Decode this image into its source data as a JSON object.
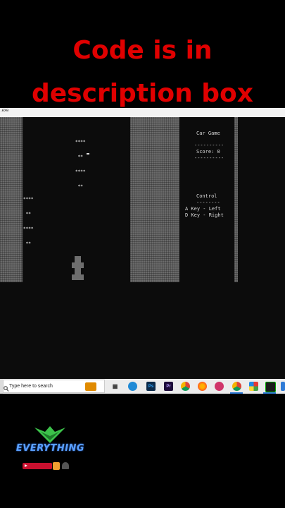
{
  "banner": {
    "line1": "Code is in",
    "line2": "description box"
  },
  "console": {
    "title": ".exe"
  },
  "game": {
    "title": "Car Game",
    "divider": "----------",
    "score_label": "Score: 0",
    "control_title": "Control",
    "control_divider": "--------",
    "control_left": "A Key - Left",
    "control_right": "D Key - Right",
    "enemy_row1": "****",
    "enemy_row2": " ** ",
    "enemy_row3": "****",
    "enemy_row4": " ** "
  },
  "taskbar": {
    "search_placeholder": "Type here to search",
    "ps_label": "Ps",
    "pr_label": "Pr"
  },
  "logo": {
    "text": "EVERYTHING"
  },
  "colors": {
    "banner": "#e00000",
    "wall": "#6a6a6a",
    "console_bg": "#0c0c0c"
  }
}
